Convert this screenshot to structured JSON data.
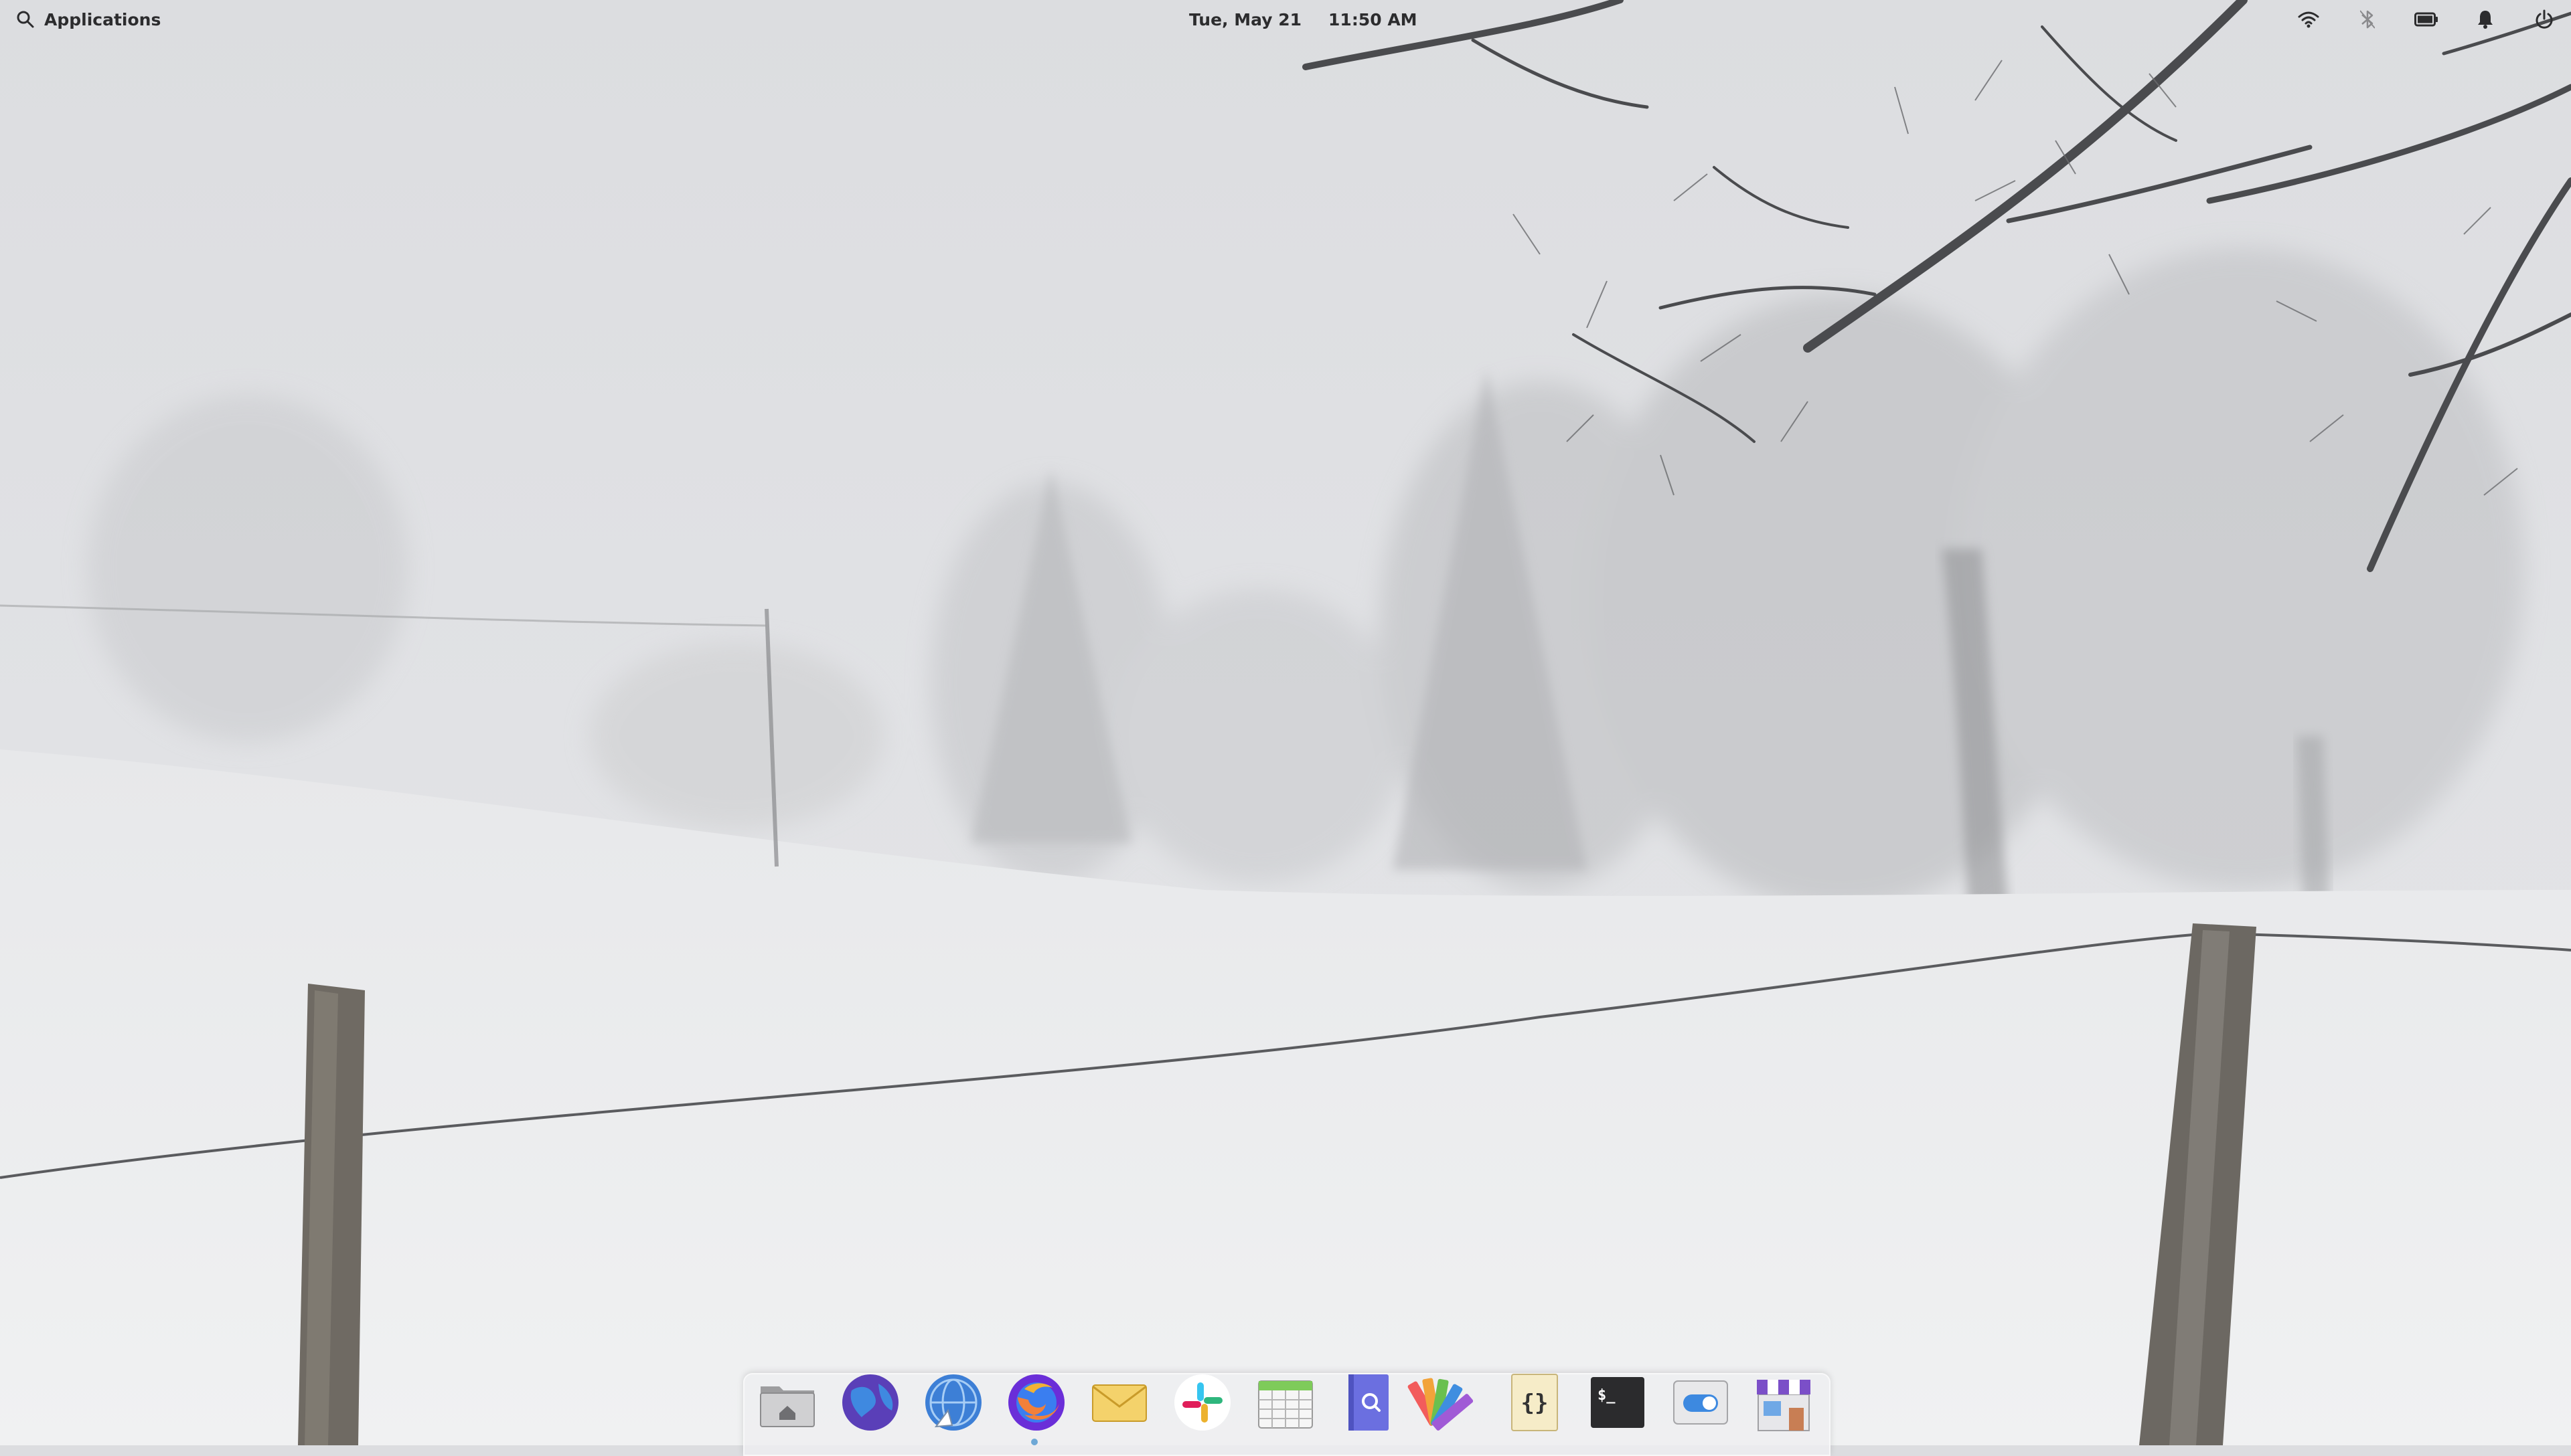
{
  "panel": {
    "applications_label": "Applications",
    "date": "Tue, May 21",
    "time": "11:50 AM",
    "indicators": [
      {
        "name": "wifi-icon"
      },
      {
        "name": "bluetooth-icon"
      },
      {
        "name": "battery-icon"
      },
      {
        "name": "notifications-bell-icon"
      },
      {
        "name": "power-icon"
      }
    ]
  },
  "dock": {
    "items": [
      {
        "name": "files-app",
        "icon": "folder-home-icon"
      },
      {
        "name": "web-browser-app",
        "icon": "globe-icon"
      },
      {
        "name": "epiphany-browser-app",
        "icon": "compass-globe-icon"
      },
      {
        "name": "firefox-app",
        "icon": "firefox-icon"
      },
      {
        "name": "mail-app",
        "icon": "envelope-icon"
      },
      {
        "name": "slack-app",
        "icon": "slack-icon"
      },
      {
        "name": "calendar-app",
        "icon": "calendar-icon"
      },
      {
        "name": "search-app",
        "icon": "magnifier-book-icon"
      },
      {
        "name": "palette-app",
        "icon": "color-palette-icon"
      },
      {
        "name": "code-app",
        "icon": "curly-braces-icon"
      },
      {
        "name": "terminal-app",
        "icon": "terminal-icon"
      },
      {
        "name": "system-settings-app",
        "icon": "toggle-switch-icon"
      },
      {
        "name": "appcenter-app",
        "icon": "store-icon"
      }
    ],
    "running_indicator": "firefox-app"
  },
  "colors": {
    "panel_text": "#2c2c2e",
    "sky": "#dfe0e3",
    "snow": "#eeeff1",
    "dock_background": "#eeeef0"
  }
}
